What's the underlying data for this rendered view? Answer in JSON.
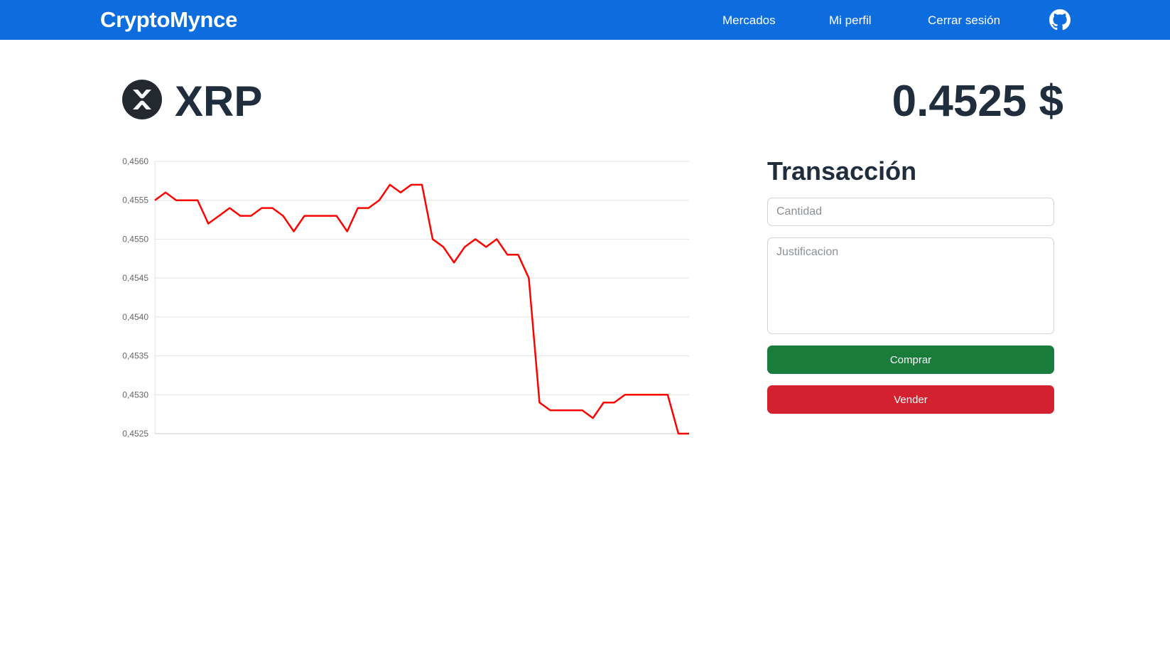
{
  "navbar": {
    "brand": "CryptoMynce",
    "links": [
      "Mercados",
      "Mi perfil",
      "Cerrar sesión"
    ],
    "github_icon": "github-icon",
    "background": "#0d6ddf"
  },
  "coin": {
    "symbol": "XRP",
    "logo_icon": "xrp-logo-icon",
    "price": "0.4525 $"
  },
  "transaction": {
    "title": "Transacción",
    "quantity_placeholder": "Cantidad",
    "justification_placeholder": "Justificacion",
    "buy_label": "Comprar",
    "sell_label": "Vender",
    "buy_color": "#197c3a",
    "sell_color": "#d3212f"
  },
  "chart_data": {
    "type": "line",
    "ylim": [
      0.4525,
      0.456
    ],
    "y_ticks": [
      "0,4560",
      "0,4555",
      "0,4550",
      "0,4545",
      "0,4540",
      "0,4535",
      "0,4530",
      "0,4525"
    ],
    "grid": true,
    "line_color": "#ff0000",
    "series": [
      {
        "values": [
          0.4555,
          0.4556,
          0.4555,
          0.4555,
          0.4555,
          0.4552,
          0.4553,
          0.4554,
          0.4553,
          0.4553,
          0.4554,
          0.4554,
          0.4553,
          0.4551,
          0.4553,
          0.4553,
          0.4553,
          0.4553,
          0.4551,
          0.4554,
          0.4554,
          0.4555,
          0.4557,
          0.4556,
          0.4557,
          0.4557,
          0.455,
          0.4549,
          0.4547,
          0.4549,
          0.455,
          0.4549,
          0.455,
          0.4548,
          0.4548,
          0.4545,
          0.4529,
          0.4528,
          0.4528,
          0.4528,
          0.4528,
          0.4527,
          0.4529,
          0.4529,
          0.453,
          0.453,
          0.453,
          0.453,
          0.453,
          0.4525,
          0.4525
        ]
      }
    ]
  }
}
